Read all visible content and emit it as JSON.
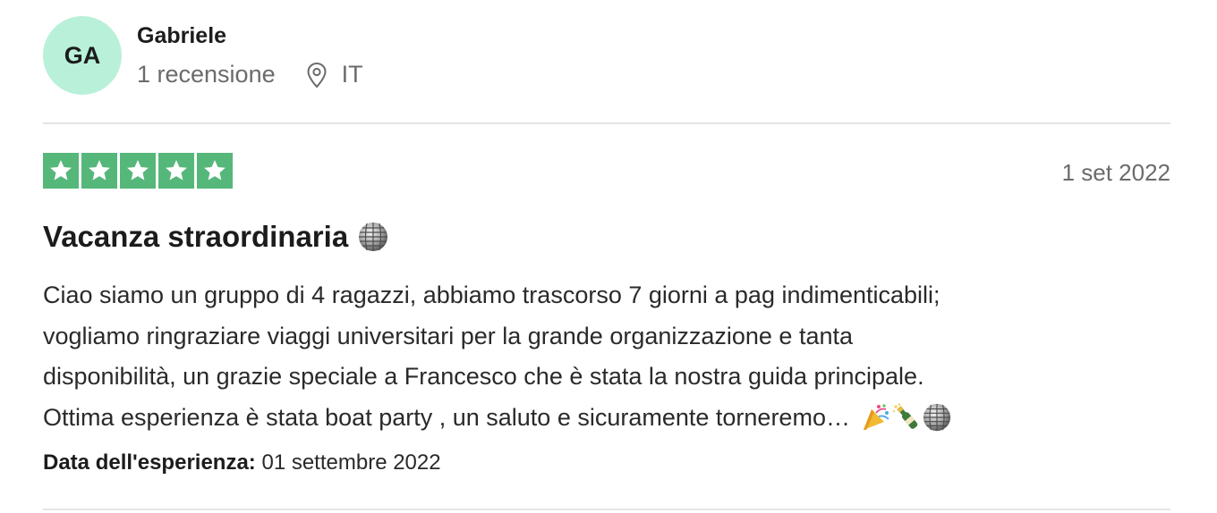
{
  "reviewer": {
    "initials": "GA",
    "name": "Gabriele",
    "review_count": "1 recensione",
    "country": "IT"
  },
  "review": {
    "rating": 5,
    "date": "1 set 2022",
    "title": "Vacanza straordinaria",
    "body_lines": [
      "Ciao siamo un gruppo di 4 ragazzi, abbiamo trascorso 7 giorni a pag indimenticabili;",
      "vogliamo ringraziare viaggi universitari per la grande organizzazione e tanta",
      "disponibilità, un grazie speciale a Francesco che è stata la nostra guida principale.",
      "Ottima esperienza è stata boat party , un saluto e sicuramente torneremo…"
    ],
    "experience_label": "Data dell'esperienza:",
    "experience_date": "01 settembre 2022"
  },
  "colors": {
    "avatar_bg": "#b9f0d9",
    "star_bg": "#56b77a",
    "muted_text": "#6b6b6b"
  },
  "icons": {
    "location": "map-pin-icon",
    "star": "star-icon",
    "title_emoji": "disco-ball-icon",
    "body_emojis": [
      "party-popper-icon",
      "champagne-bottle-icon",
      "disco-ball-icon"
    ]
  }
}
